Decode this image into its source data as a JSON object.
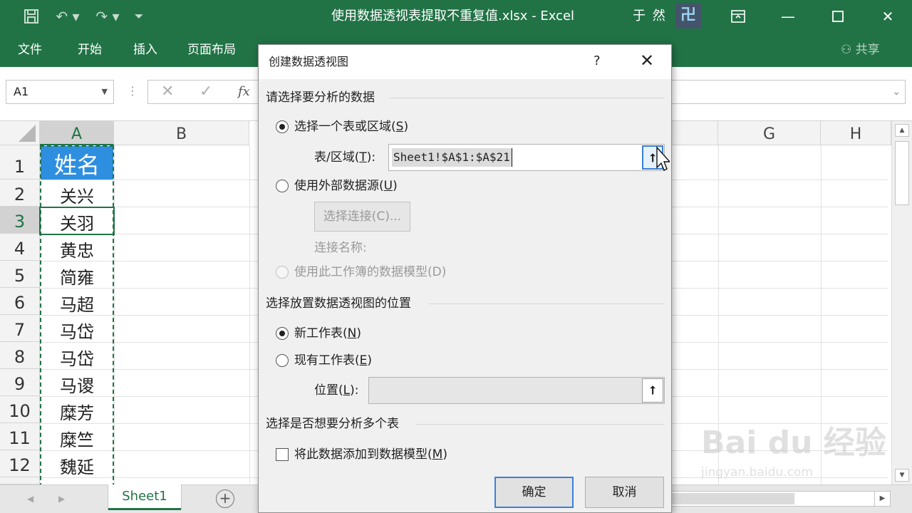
{
  "window": {
    "title": "使用数据透视表提取不重复值.xlsx  -  Excel",
    "user": "于 然",
    "user_badge": "卍",
    "qat": {
      "save_icon": "save-icon",
      "undo_icon": "undo-icon",
      "redo_icon": "redo-icon",
      "customize_icon": "customize-icon"
    },
    "controls": {
      "ribbon_display": "ribbon-display-icon",
      "minimize": "minimize-icon",
      "maximize": "maximize-icon",
      "close": "close-icon"
    }
  },
  "ribbon": {
    "tabs": [
      "文件",
      "开始",
      "插入",
      "页面布局"
    ],
    "share": "共享"
  },
  "formula_bar": {
    "name_box": "A1",
    "cancel": "✕",
    "enter": "✓",
    "fx": "fx",
    "content": ""
  },
  "sheet": {
    "columns": [
      "A",
      "B",
      "G",
      "H"
    ],
    "rows": [
      "1",
      "2",
      "3",
      "4",
      "5",
      "6",
      "7",
      "8",
      "9",
      "10",
      "11",
      "12"
    ],
    "column_a": [
      "姓名",
      "关兴",
      "关羽",
      "黄忠",
      "简雍",
      "马超",
      "马岱",
      "马岱",
      "马谡",
      "糜芳",
      "糜竺",
      "魏延"
    ],
    "selected_column": "A",
    "selected_row": "3",
    "tab_name": "Sheet1",
    "add_sheet": "+"
  },
  "dialog": {
    "title": "创建数据透视图",
    "help": "?",
    "close": "✕",
    "section_data": "请选择要分析的数据",
    "radio_table": {
      "text": "选择一个表或区域(",
      "key": "S",
      "end": ")"
    },
    "range_label": {
      "text": "表/区域(",
      "key": "T",
      "end": "):"
    },
    "range_value": "Sheet1!$A$1:$A$21",
    "radio_external": {
      "text": "使用外部数据源(",
      "key": "U",
      "end": ")"
    },
    "choose_connection": "选择连接(C)...",
    "connection_name": "连接名称:",
    "radio_model": "使用此工作簿的数据模型(D)",
    "section_location": "选择放置数据透视图的位置",
    "radio_new": {
      "text": "新工作表(",
      "key": "N",
      "end": ")"
    },
    "radio_existing": {
      "text": "现有工作表(",
      "key": "E",
      "end": ")"
    },
    "location_label": {
      "text": "位置(",
      "key": "L",
      "end": "):"
    },
    "location_value": "",
    "section_multi": "选择是否想要分析多个表",
    "checkbox_model": {
      "text": "将此数据添加到数据模型(",
      "key": "M",
      "end": ")"
    },
    "ok": "确定",
    "cancel": "取消",
    "selected_source": "table",
    "selected_location": "new_worksheet",
    "add_to_model": false
  },
  "watermark": {
    "text": "Bai du 经验",
    "url": "jingyan.baidu.com"
  },
  "colors": {
    "excel_green": "#217346",
    "header_cell_fill": "#2e8fe0",
    "dialog_bg": "#f0f0f0",
    "focus_blue": "#3c7fd6"
  }
}
